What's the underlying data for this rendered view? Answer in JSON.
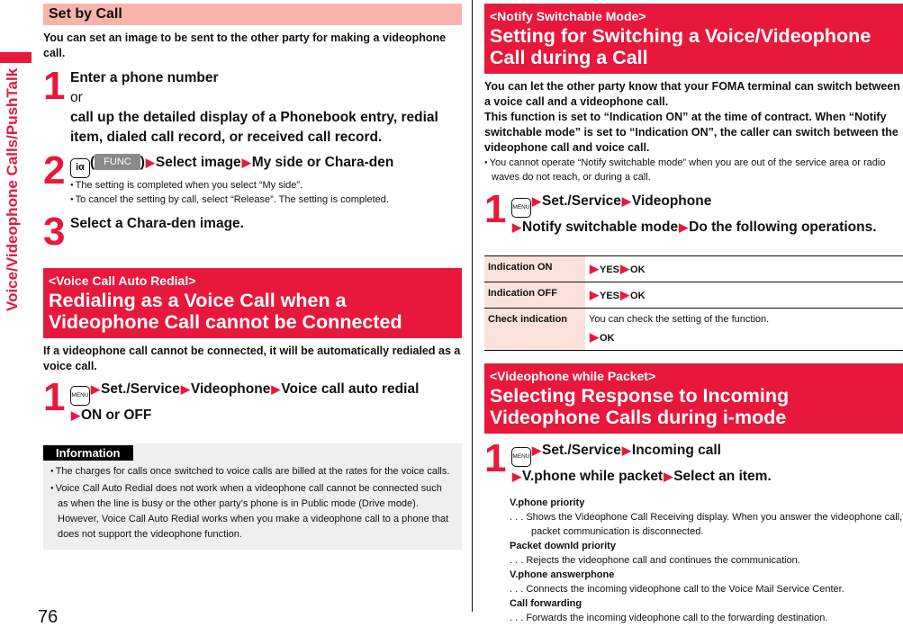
{
  "side_tab": {
    "label": "Voice/Videophone Calls/PushTalk",
    "accent_color": "#e8183c"
  },
  "page_number": "76",
  "left": {
    "set_by_call": {
      "heading": "Set by Call",
      "intro": "You can set an image to be sent to the other party for making a videophone call.",
      "steps": [
        {
          "num": "1",
          "line1": "Enter a phone number",
          "or": "or",
          "line2": "call up the detailed display of a Phonebook entry, redial item, dialed call record, or received call record."
        },
        {
          "num": "2",
          "key_icon": "iα",
          "func_label": "FUNC",
          "path": [
            "Select image",
            "My side or Chara-den"
          ],
          "bullets": [
            "The setting is completed when you select “My side”.",
            "To cancel the setting by call, select “Release”. The setting is completed."
          ]
        },
        {
          "num": "3",
          "line1": "Select a Chara-den image."
        }
      ]
    },
    "auto_redial": {
      "subtitle": "<Voice Call Auto Redial>",
      "title": "Redialing as a Voice Call when a Videophone Call cannot be Connected",
      "intro": "If a videophone call cannot be connected, it will be automatically redialed as a voice call.",
      "step": {
        "num": "1",
        "key_icon": "MENU",
        "path": [
          "Set./Service",
          "Videophone",
          "Voice call auto redial",
          "ON or OFF"
        ]
      }
    },
    "information": {
      "label": "Information",
      "items": [
        "The charges for calls once switched to voice calls are billed at the rates for the voice calls.",
        "Voice Call Auto Redial does not work when a videophone call cannot be connected such as when the line is busy or the other party’s phone is in Public mode (Drive mode). However, Voice Call Auto Redial works when you make a videophone call to a phone that does not support the videophone function."
      ]
    }
  },
  "right": {
    "notify": {
      "subtitle": "<Notify Switchable Mode>",
      "title": "Setting for Switching a Voice/Videophone Call during a Call",
      "intro": "You can let the other party know that your FOMA terminal can switch between a voice call and a videophone call.\nThis function is set to “Indication ON” at the time of contract. When “Notify switchable mode” is set to “Indication ON”, the caller can switch between the videophone call and voice call.",
      "bullet": "You cannot operate “Notify switchable mode” when you are out of the service area or radio waves do not reach, or during a call.",
      "step": {
        "num": "1",
        "key_icon": "MENU",
        "path": [
          "Set./Service",
          "Videophone",
          "Notify switchable mode",
          "Do the following operations."
        ]
      },
      "table": [
        {
          "label": "Indication ON",
          "desc": "",
          "path": [
            "YES",
            "OK"
          ]
        },
        {
          "label": "Indication OFF",
          "desc": "",
          "path": [
            "YES",
            "OK"
          ]
        },
        {
          "label": "Check indication",
          "desc": "You can check the setting of the function.",
          "path": [
            "OK"
          ]
        }
      ]
    },
    "packet": {
      "subtitle": "<Videophone while Packet>",
      "title": "Selecting Response to Incoming Videophone Calls during i-mode",
      "step": {
        "num": "1",
        "key_icon": "MENU",
        "path": [
          "Set./Service",
          "Incoming call",
          "V.phone while packet",
          "Select an item."
        ]
      },
      "options": [
        {
          "name": "V.phone priority",
          "desc": ". . .  Shows the Videophone Call Receiving display. When you answer the videophone call, packet communication is disconnected."
        },
        {
          "name": "Packet downld priority",
          "desc": ". . .  Rejects the videophone call and continues the communication."
        },
        {
          "name": "V.phone answerphone",
          "desc": ". . .  Connects the incoming videophone call to the Voice Mail Service Center."
        },
        {
          "name": "Call forwarding",
          "desc": ". . .  Forwards the incoming videophone call to the forwarding destination."
        }
      ]
    }
  }
}
